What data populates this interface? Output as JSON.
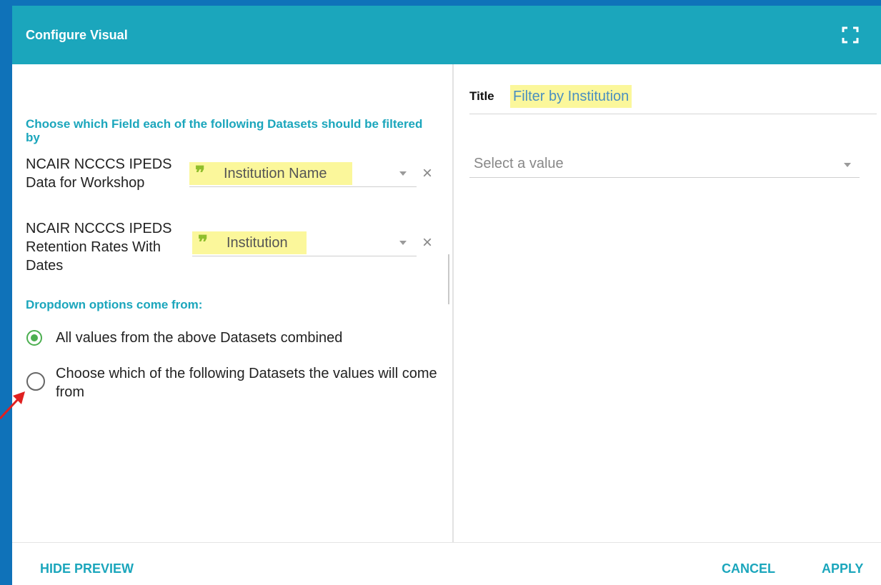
{
  "dialog": {
    "title": "Configure Visual"
  },
  "left": {
    "datasets_heading": "Choose which Field each of the following Datasets should be filtered by",
    "datasets": [
      {
        "name": "NCAIR NCCCS IPEDS Data for Workshop",
        "field": "Institution Name",
        "field_icon": "quote-icon"
      },
      {
        "name": "NCAIR NCCCS IPEDS Retention Rates With Dates",
        "field": "Institution",
        "field_icon": "quote-icon"
      }
    ],
    "options_heading": "Dropdown options come from:",
    "options": [
      {
        "label": "All values from the above Datasets combined",
        "selected": true
      },
      {
        "label": "Choose which of the following Datasets the values will come from",
        "selected": false
      }
    ]
  },
  "right": {
    "title_label": "Title",
    "title_value": "Filter by Institution",
    "value_placeholder": "Select a value"
  },
  "footer": {
    "hide_preview": "HIDE PREVIEW",
    "cancel": "CANCEL",
    "apply": "APPLY"
  },
  "colors": {
    "header": "#1ba6bc",
    "accent": "#1ba6bc",
    "highlight": "#fbf79b",
    "radio_selected": "#4caf50",
    "page_background": "#0f72b9",
    "annotation_arrow": "#e02020"
  }
}
